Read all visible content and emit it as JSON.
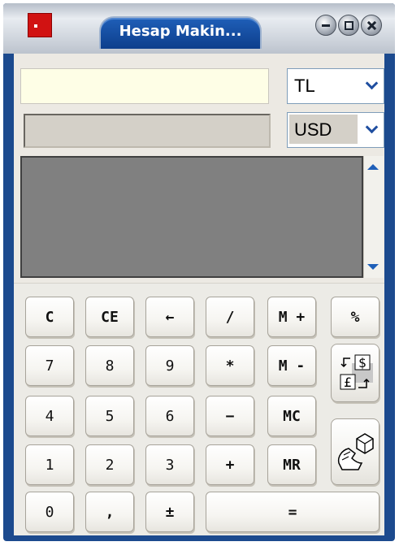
{
  "window": {
    "title": "Hesap Makin...",
    "buttons": [
      "minimize-icon",
      "maximize-icon",
      "close-icon"
    ]
  },
  "converter": {
    "amount_value": "",
    "result_value": "",
    "from_currency": "TL",
    "to_currency": "USD"
  },
  "history": {
    "entries": []
  },
  "keypad": {
    "row1": [
      "C",
      "CE",
      "←",
      "/",
      "M +",
      "%"
    ],
    "row2": [
      "7",
      "8",
      "9",
      "*",
      "M -"
    ],
    "row3": [
      "4",
      "5",
      "6",
      "−",
      "MC"
    ],
    "row4": [
      "1",
      "2",
      "3",
      "+",
      "MR"
    ],
    "row5": [
      "0",
      ",",
      "±",
      "="
    ],
    "side_icons": [
      "currency-convert-icon",
      "copy-to-clipboard-icon"
    ]
  },
  "colors": {
    "title_bar": "#1f5fb8",
    "frame": "#1c4a8e",
    "panel": "#ece9e3",
    "amount_bg": "#fefee6",
    "history_bg": "#808080",
    "accent_arrow": "#1f4ea0"
  }
}
